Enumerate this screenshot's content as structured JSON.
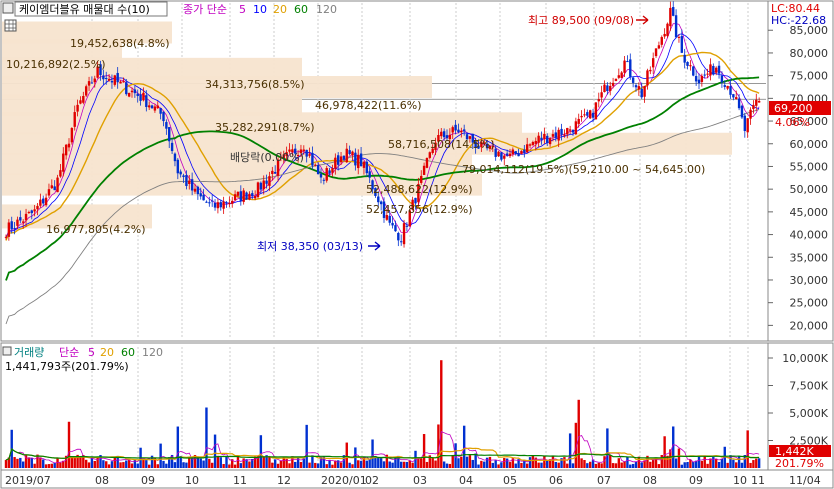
{
  "header": {
    "stock_label": "케이엠더블유 매물대 수(10)",
    "ma_label": "종가 단순",
    "ma_periods": [
      "5",
      "10",
      "20",
      "60",
      "120"
    ],
    "ma_colors": [
      "#c000c0",
      "#0000ff",
      "#e0a000",
      "#008000",
      "#808080"
    ]
  },
  "top_right": {
    "lc": "LC:80.44",
    "hc": "HC:-22.68"
  },
  "volume_header": {
    "label": "거래량",
    "ma_label": "단순",
    "ma_periods": [
      "5",
      "20",
      "60",
      "120"
    ],
    "value": "1,441,793주(201.79%)"
  },
  "price_badge": {
    "value": "69,200",
    "pct": "4.06%"
  },
  "volume_badge": {
    "value": "1,442K",
    "pct": "201.79%"
  },
  "annotations": {
    "high": "최고 89,500 (09/08)",
    "low": "최저 38,350 (03/13)",
    "dividend": "배당락(0.00%)"
  },
  "chart_data": {
    "type": "candlestick",
    "price_axis": {
      "ticks": [
        20000,
        25000,
        30000,
        35000,
        40000,
        45000,
        50000,
        55000,
        60000,
        65000,
        70000,
        75000,
        80000,
        85000
      ],
      "tick_labels": [
        "20,000",
        "25,000",
        "30,000",
        "35,000",
        "40,000",
        "45,000",
        "50,000",
        "55,000",
        "60,000",
        "65,000",
        "70,000",
        "75,000",
        "80,000",
        "85,000"
      ],
      "range": [
        17000,
        91000
      ]
    },
    "volume_axis": {
      "ticks": [
        2500,
        5000,
        7500,
        10000
      ],
      "tick_labels": [
        "2,500K",
        "5,000K",
        "7,500K",
        "10,000K"
      ],
      "range": [
        0,
        11000
      ]
    },
    "x_labels": [
      "2019/07",
      "08",
      "09",
      "10",
      "11",
      "12",
      "2020/01",
      "02",
      "03",
      "04",
      "05",
      "06",
      "07",
      "08",
      "09",
      "10",
      "11",
      "11/04"
    ],
    "volume_profile": [
      {
        "label": "19,452,638(4.8%)"
      },
      {
        "label": "10,216,892(2.5%)"
      },
      {
        "label": "34,313,756(8.5%)"
      },
      {
        "label": "46,978,422(11.6%)"
      },
      {
        "label": "35,282,291(8.7%)"
      },
      {
        "label": "58,716,508(14.5%)"
      },
      {
        "label": "79,014,112(19.5%)(59,210.00 ~ 54,645.00)"
      },
      {
        "label": "52,488,622(12.9%)"
      },
      {
        "label": "52,457,856(12.9%)"
      },
      {
        "label": "16,977,805(4.2%)"
      }
    ],
    "anchor_points": [
      [
        0,
        41000
      ],
      [
        10,
        45000
      ],
      [
        18,
        52000
      ],
      [
        25,
        68000
      ],
      [
        32,
        76000
      ],
      [
        40,
        73000
      ],
      [
        48,
        70000
      ],
      [
        55,
        66000
      ],
      [
        60,
        54000
      ],
      [
        66,
        49000
      ],
      [
        72,
        46000
      ],
      [
        80,
        48000
      ],
      [
        88,
        50000
      ],
      [
        96,
        56000
      ],
      [
        104,
        60000
      ],
      [
        110,
        52000
      ],
      [
        118,
        58000
      ],
      [
        124,
        56000
      ],
      [
        130,
        48000
      ],
      [
        134,
        42000
      ],
      [
        138,
        39500
      ],
      [
        144,
        50000
      ],
      [
        150,
        61000
      ],
      [
        158,
        63000
      ],
      [
        166,
        59000
      ],
      [
        176,
        57000
      ],
      [
        186,
        61000
      ],
      [
        196,
        63000
      ],
      [
        204,
        66000
      ],
      [
        210,
        73000
      ],
      [
        216,
        78000
      ],
      [
        222,
        71000
      ],
      [
        228,
        82000
      ],
      [
        232,
        89000
      ],
      [
        236,
        80000
      ],
      [
        242,
        74000
      ],
      [
        248,
        77000
      ],
      [
        254,
        71000
      ],
      [
        258,
        63000
      ],
      [
        262,
        69200
      ]
    ]
  }
}
